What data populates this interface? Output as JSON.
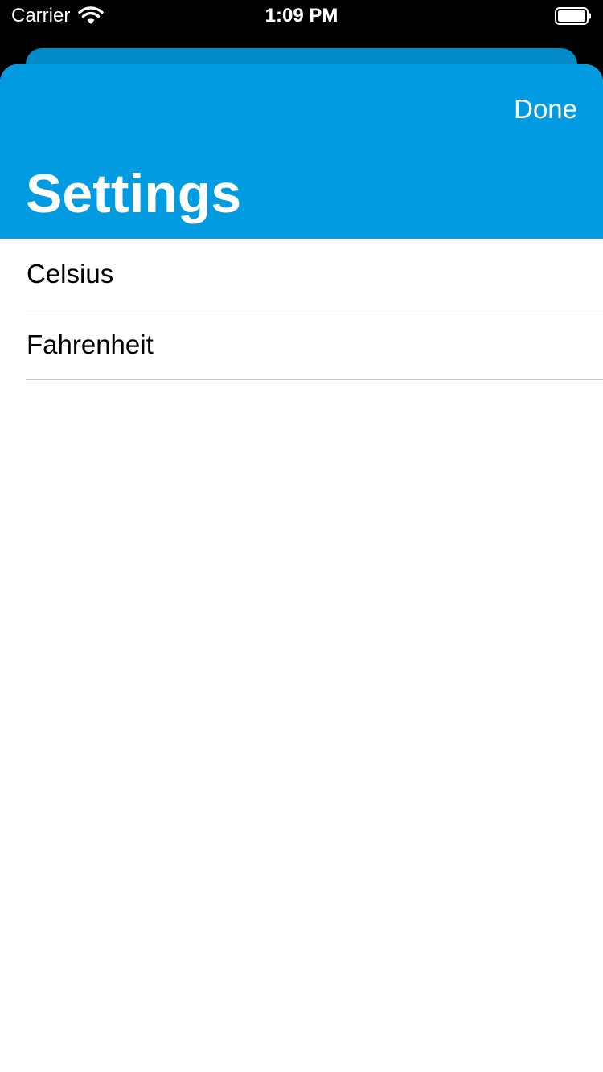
{
  "status_bar": {
    "carrier": "Carrier",
    "time": "1:09 PM",
    "wifi_icon": "wifi-icon",
    "battery_icon": "battery-full-icon"
  },
  "header": {
    "title": "Settings",
    "done_label": "Done",
    "color": "#009BE0"
  },
  "units": {
    "items": [
      {
        "label": "Celsius"
      },
      {
        "label": "Fahrenheit"
      }
    ]
  }
}
